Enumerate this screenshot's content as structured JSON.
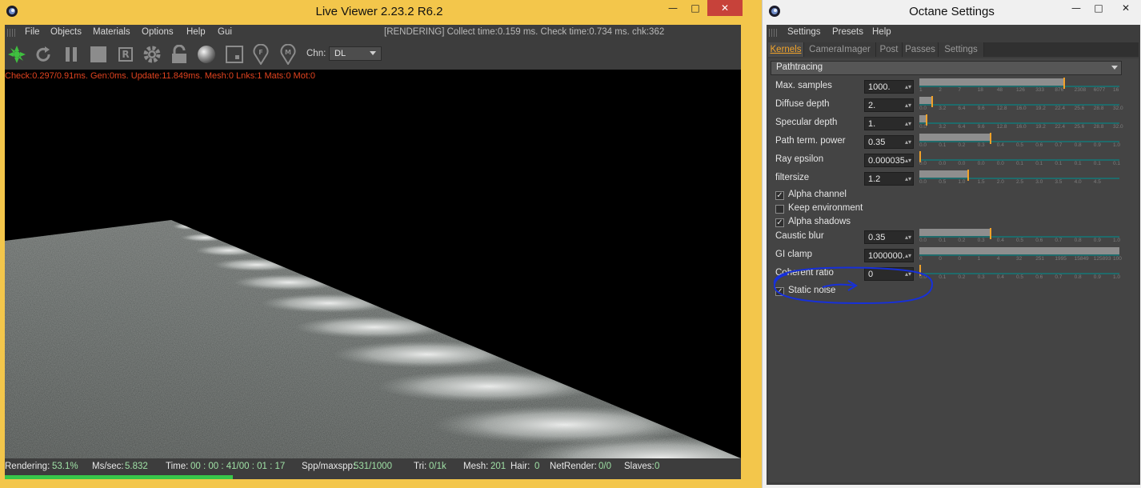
{
  "live_viewer": {
    "title": "Live Viewer 2.23.2 R6.2",
    "window_buttons": {
      "minimize": "—",
      "maximize": "□",
      "close": "✕"
    },
    "menu": [
      "File",
      "Objects",
      "Materials",
      "Options",
      "Help",
      "Gui"
    ],
    "render_status": "[RENDERING] Collect time:0.159 ms.  Check time:0.734 ms.  chk:362",
    "toolbar": {
      "icons": [
        "octane-logo-icon",
        "restart-icon",
        "pause-icon",
        "stop-icon",
        "region-render-icon",
        "settings-gear-icon",
        "lock-icon",
        "material-sphere-icon",
        "focus-pick-icon",
        "focus-picker-icon",
        "material-picker-icon"
      ],
      "region_glyph": "R",
      "focus_glyph": "F",
      "material_glyph": "M",
      "channel_label": "Chn:",
      "channel_value": "DL"
    },
    "stats_line": "Check:0.297/0.91ms. Gen:0ms. Update:11.849ms. Mesh:0 Lnks:1 Mats:0 Mot:0",
    "status": {
      "rendering_label": "Rendering:",
      "rendering_value": "53.1%",
      "mspersec_label": "Ms/sec:",
      "mspersec_value": "5.832",
      "time_label": "Time:",
      "time_value": "00 : 00 : 41/00 : 01 : 17",
      "spp_label": "Spp/maxspp:",
      "spp_value": "531/1000",
      "tri_label": "Tri:",
      "tri_value": "0/1k",
      "mesh_label": "Mesh:",
      "mesh_value": "201",
      "hair_label": "Hair:",
      "hair_value": "0",
      "netrender_label": "NetRender:",
      "netrender_value": "0/0",
      "slaves_label": "Slaves:",
      "slaves_value": "0"
    },
    "progress": 0.531
  },
  "octane_settings": {
    "title": "Octane Settings",
    "window_buttons": {
      "minimize": "—",
      "maximize": "□",
      "close": "✕"
    },
    "menu": [
      "Settings",
      "Presets",
      "Help"
    ],
    "tabs": [
      "Kernels",
      "CameraImager",
      "Post",
      "Passes",
      "Settings"
    ],
    "active_tab": "Kernels",
    "kernel_dropdown": "Pathtracing",
    "params": [
      {
        "label": "Max. samples",
        "value": "1000.",
        "fill": 0.72,
        "mark": 0.72,
        "ticks": [
          "1",
          "2",
          "7",
          "18",
          "48",
          "126",
          "333",
          "876",
          "2308",
          "6077",
          "16"
        ]
      },
      {
        "label": "Diffuse depth",
        "value": "2.",
        "fill": 0.06,
        "mark": 0.06,
        "ticks": [
          "0.0",
          "3.2",
          "6.4",
          "9.6",
          "12.8",
          "16.0",
          "19.2",
          "22.4",
          "25.6",
          "28.8",
          "32.0"
        ]
      },
      {
        "label": "Specular depth",
        "value": "1.",
        "fill": 0.03,
        "mark": 0.03,
        "ticks": [
          "0.0",
          "3.2",
          "6.4",
          "9.6",
          "12.8",
          "16.0",
          "19.2",
          "22.4",
          "25.6",
          "28.8",
          "32.0"
        ]
      },
      {
        "label": "Path term. power",
        "value": "0.35",
        "fill": 0.35,
        "mark": 0.35,
        "ticks": [
          "0.0",
          "0.1",
          "0.2",
          "0.3",
          "0.4",
          "0.5",
          "0.6",
          "0.7",
          "0.8",
          "0.9",
          "1.0"
        ]
      },
      {
        "label": "Ray epsilon",
        "value": "0.000035",
        "fill": 0.0,
        "mark": 0.0,
        "ticks": [
          "0.0",
          "0.0",
          "0.0",
          "0.0",
          "0.0",
          "0.1",
          "0.1",
          "0.1",
          "0.1",
          "0.1",
          "0.1"
        ]
      },
      {
        "label": "filtersize",
        "value": "1.2",
        "fill": 0.24,
        "mark": 0.24,
        "ticks": [
          "0.0",
          "0.5",
          "1.0",
          "1.5",
          "2.0",
          "2.5",
          "3.0",
          "3.5",
          "4.0",
          "4.5",
          ""
        ]
      }
    ],
    "checkboxes": [
      {
        "label": "Alpha channel",
        "checked": true
      },
      {
        "label": "Keep environment",
        "checked": false
      },
      {
        "label": "Alpha shadows",
        "checked": true
      }
    ],
    "params2": [
      {
        "label": "Caustic blur",
        "value": "0.35",
        "fill": 0.35,
        "mark": 0.35,
        "ticks": [
          "0.0",
          "0.1",
          "0.2",
          "0.3",
          "0.4",
          "0.5",
          "0.6",
          "0.7",
          "0.8",
          "0.9",
          "1.0"
        ]
      },
      {
        "label": "GI clamp",
        "value": "1000000.",
        "fill": 1.0,
        "mark": -1,
        "ticks": [
          "0",
          "0",
          "0",
          "1",
          "4",
          "32",
          "251",
          "1995",
          "15849",
          "125893",
          "100"
        ]
      },
      {
        "label": "Coherent ratio",
        "value": "0",
        "fill": 0.0,
        "mark": 0.0,
        "ticks": [
          "0.0",
          "0.1",
          "0.2",
          "0.3",
          "0.4",
          "0.5",
          "0.6",
          "0.7",
          "0.8",
          "0.9",
          "1.0"
        ]
      }
    ],
    "static_noise": {
      "label": "Static noise",
      "checked": true
    },
    "colors": {
      "accent": "#f0a22a",
      "annotation": "#1730d9",
      "tab_active": "#f0a22a"
    }
  }
}
